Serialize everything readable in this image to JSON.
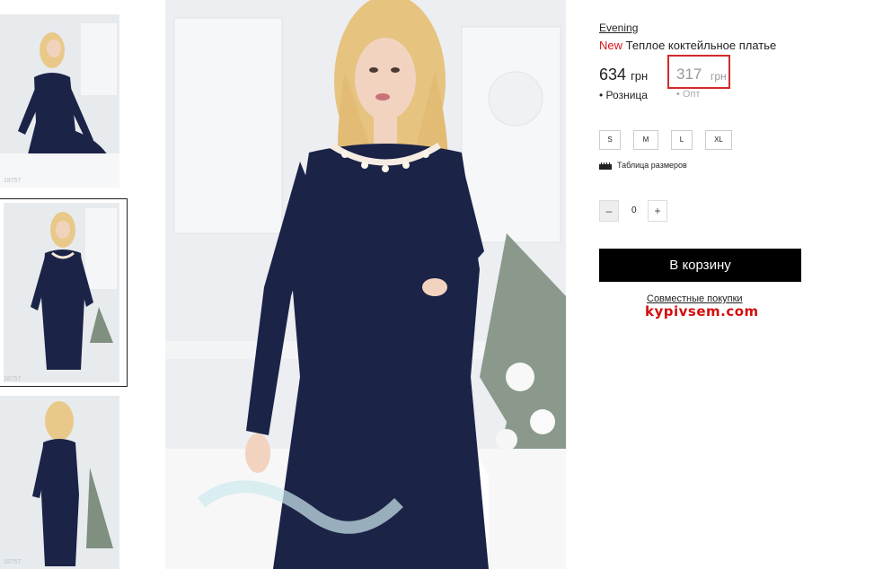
{
  "gallery": {
    "thumbnails": [
      {
        "sku": "18757"
      },
      {
        "sku": "18757"
      },
      {
        "sku": "18757"
      }
    ]
  },
  "product": {
    "brand": "Evening",
    "new_badge": "New",
    "name": "Теплое коктейльное платье",
    "price": "634",
    "price_currency": "грн",
    "price_label": "Розница",
    "opt_price": "317",
    "opt_currency": "грн",
    "opt_label": "Опт",
    "sizes": [
      "S",
      "M",
      "L",
      "XL"
    ],
    "size_chart": "Таблица размеров",
    "quantity": "0",
    "minus": "–",
    "plus": "+",
    "add_to_cart": "В корзину"
  },
  "promo": {
    "joint_purchase": "Совместные покупки",
    "site": "kypivsem.com"
  },
  "colors": {
    "accent": "#d7141a",
    "button": "#000000",
    "dress": "#1b2347"
  }
}
